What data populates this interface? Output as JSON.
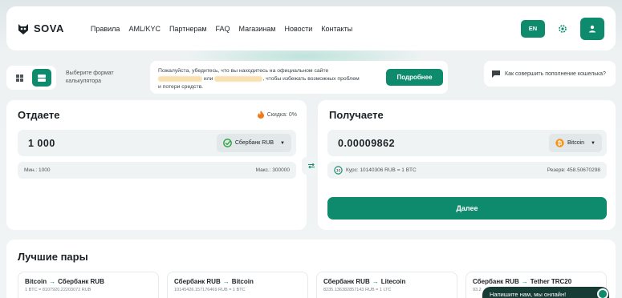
{
  "brand": {
    "name": "SOVA"
  },
  "nav": [
    "Правила",
    "AML/KYC",
    "Партнерам",
    "FAQ",
    "Магазинам",
    "Новости",
    "Контакты"
  ],
  "header": {
    "lang": "EN"
  },
  "view": {
    "label_line1": "Выберите формат",
    "label_line2": "калькулятора"
  },
  "notice": {
    "text_before": "Пожалуйста, убедитесь, что вы находитесь на официальном сайте",
    "text_or": "или",
    "text_after": ", чтобы избежать возможных проблем",
    "text_line3": "и потери средств.",
    "button": "Подробнее"
  },
  "faq": {
    "text": "Как совершить пополнение кошелька?"
  },
  "give": {
    "title": "Отдаете",
    "discount": "Скидка: 0%",
    "amount": "1 000",
    "currency": "Сбербанк RUB",
    "min": "Мин.: 1000",
    "max": "Макс.: 300000"
  },
  "get": {
    "title": "Получаете",
    "amount": "0.00009862",
    "currency": "Bitcoin",
    "timer": "30",
    "rate": "Курс: 10140306 RUB = 1 BTC",
    "reserve": "Резерв: 458.50670298",
    "button": "Далее"
  },
  "best": {
    "title": "Лучшие пары",
    "pairs": [
      {
        "from": "Bitcoin",
        "to": "Сбербанк RUB",
        "rate": "1 BTC = 8107920.22203072 RUB"
      },
      {
        "from": "Сбербанк RUB",
        "to": "Bitcoin",
        "rate": "10145426.157176469 RUB = 1 BTC"
      },
      {
        "from": "Сбербанк RUB",
        "to": "Litecoin",
        "rate": "8235.136382857143 RUB = 1 LTC"
      },
      {
        "from": "Сбербанк RUB",
        "to": "Tether TRC20",
        "rate": "93.2"
      }
    ]
  },
  "chat": {
    "text": "Напишите нам, мы онлайн!"
  },
  "colors": {
    "accent": "#0e8a6c",
    "background": "#f1f4f5",
    "chat": "#173b35"
  }
}
